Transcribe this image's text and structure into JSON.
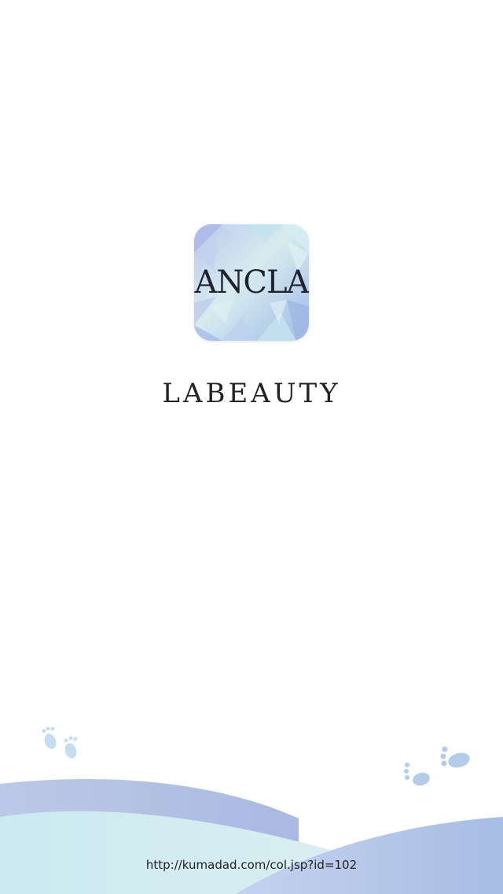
{
  "app_icon": {
    "logo_text": "ANCLA"
  },
  "brand": {
    "name": "LABEAUTY"
  },
  "footer": {
    "url": "http://kumadad.com/col.jsp?id=102"
  },
  "decorations": {
    "icons": [
      "footprints-icon",
      "footprints-icon"
    ]
  },
  "colors": {
    "background": "#ffffff",
    "wave_light": "#cfe9ef",
    "wave_dark": "#aebfe2",
    "footprint": "#bcd4ea",
    "text": "#222222"
  }
}
